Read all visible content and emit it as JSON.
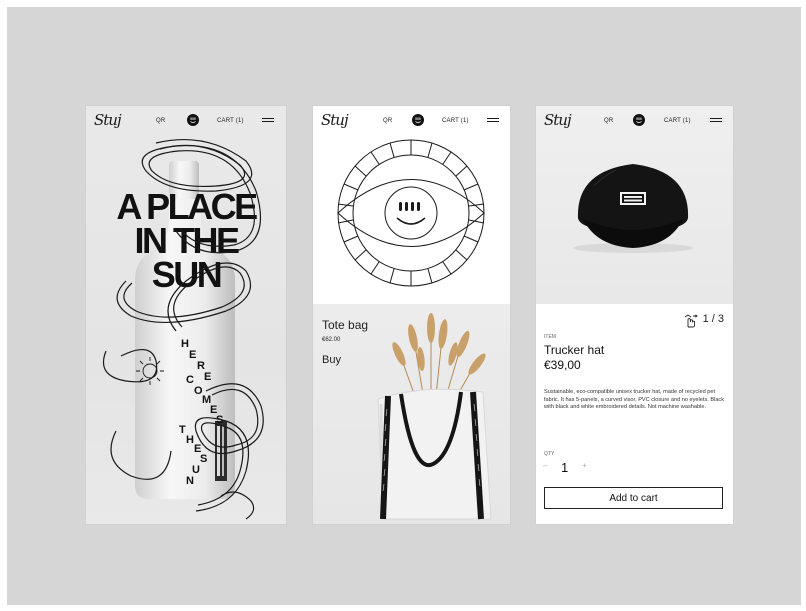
{
  "nav": {
    "logo": "Stuj",
    "qr_label": "QR",
    "cart_label": "CART (1)"
  },
  "screen1": {
    "headline_lines": [
      "A PLACE",
      "IN THE",
      "SUN"
    ],
    "wave_letters": [
      "H",
      "E",
      "R",
      "E",
      "C",
      "O",
      "M",
      "E",
      "S",
      "T",
      "H",
      "E",
      "S",
      "U",
      "N"
    ]
  },
  "screen2": {
    "product_name": "Tote bag",
    "product_price": "€62.00",
    "buy_label": "Buy"
  },
  "screen3": {
    "gallery_count": "1 / 3",
    "item_label": "ITEM",
    "item_name": "Trucker hat",
    "item_price": "€39,00",
    "description": "Sustainable, eco-compatible unisex trucker hat, made of recycled pet fabric. It has 5-panels, a curved visor, PVC closure and no eyelets. Black with black and white embroidered details. Not machine washable.",
    "qty_label": "QTY",
    "qty_minus": "–",
    "qty_value": "1",
    "qty_plus": "+",
    "add_to_cart_label": "Add to cart"
  },
  "colors": {
    "background": "#d6d6d6",
    "ink": "#1a1a1a",
    "hat": "#111111",
    "wheat": "#c9a06a"
  },
  "icons": [
    "smiley-icon",
    "menu-icon",
    "eye-sun-icon",
    "swipe-hand-icon"
  ]
}
